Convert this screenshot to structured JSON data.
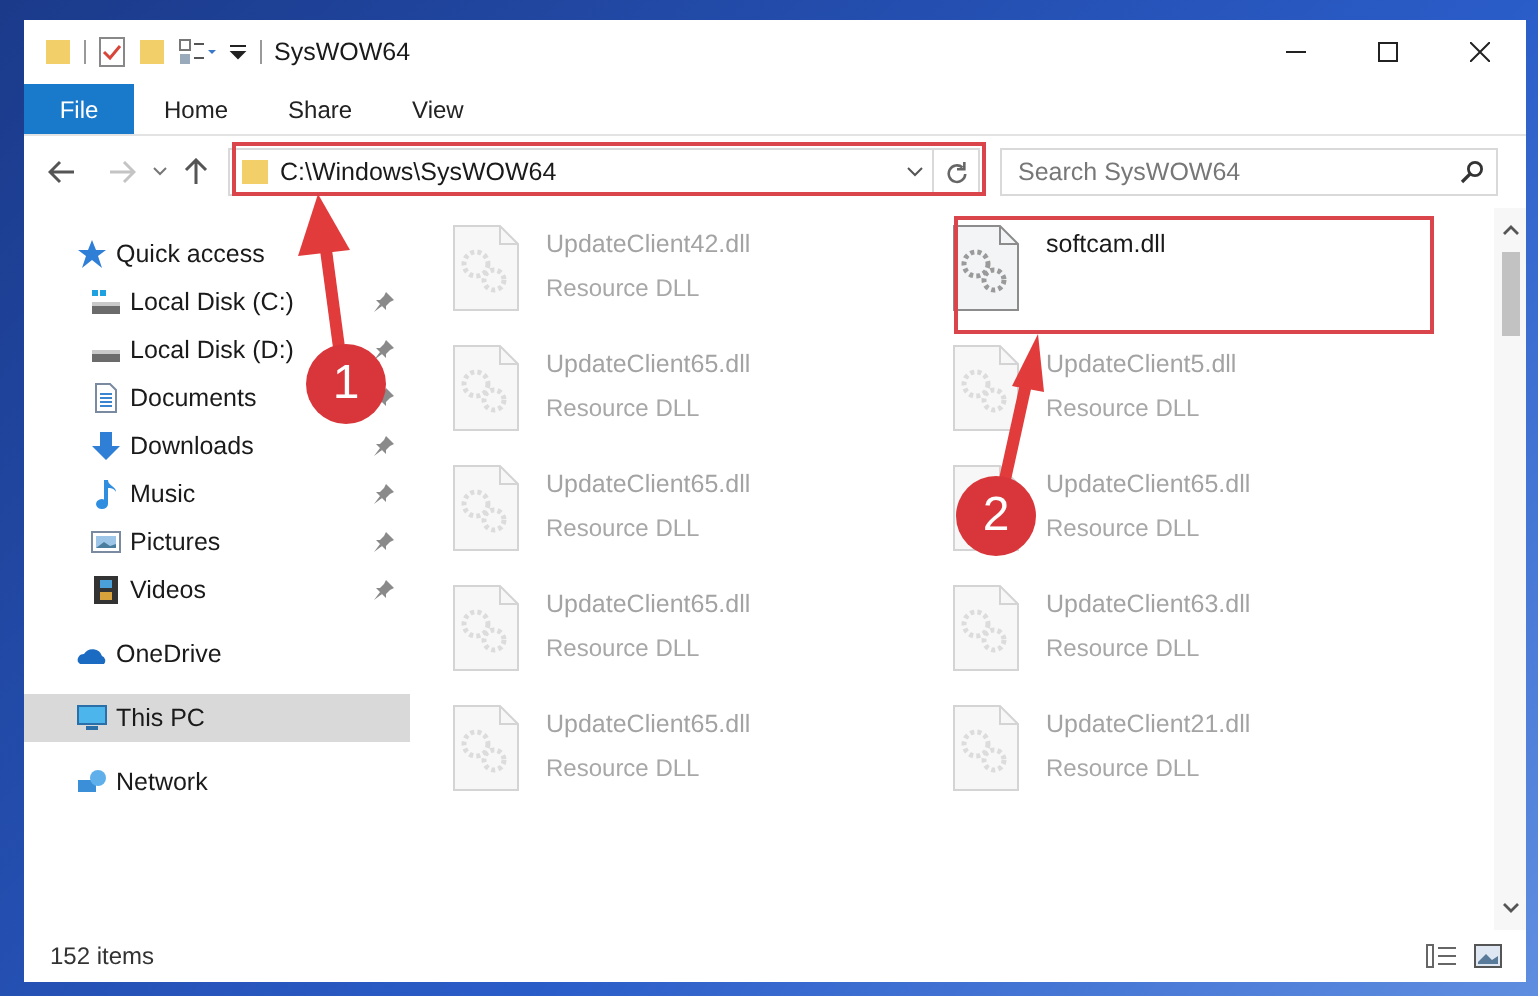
{
  "window": {
    "title": "SysWOW64"
  },
  "ribbon_tabs": [
    {
      "label": "File",
      "selected": true
    },
    {
      "label": "Home",
      "selected": false
    },
    {
      "label": "Share",
      "selected": false
    },
    {
      "label": "View",
      "selected": false
    }
  ],
  "address": {
    "path": "C:\\Windows\\SysWOW64"
  },
  "search": {
    "placeholder": "Search SysWOW64"
  },
  "sidebar": {
    "items": [
      {
        "label": "Quick access",
        "kind": "star",
        "selected": false,
        "children": [
          {
            "label": "Local Disk (C:)",
            "kind": "disk_c",
            "pinned": true,
            "selected": false
          },
          {
            "label": "Local Disk (D:)",
            "kind": "disk",
            "pinned": true,
            "selected": false
          },
          {
            "label": "Documents",
            "kind": "documents",
            "pinned": true,
            "selected": false
          },
          {
            "label": "Downloads",
            "kind": "downloads",
            "pinned": true,
            "selected": false
          },
          {
            "label": "Music",
            "kind": "music",
            "pinned": true,
            "selected": false
          },
          {
            "label": "Pictures",
            "kind": "pictures",
            "pinned": true,
            "selected": false
          },
          {
            "label": "Videos",
            "kind": "videos",
            "pinned": true,
            "selected": false
          }
        ]
      },
      {
        "label": "OneDrive",
        "kind": "cloud",
        "selected": false
      },
      {
        "label": "This PC",
        "kind": "pc",
        "selected": true
      },
      {
        "label": "Network",
        "kind": "network",
        "selected": false
      }
    ]
  },
  "files": [
    {
      "name": "UpdateClient42.dll",
      "type": "Resource DLL",
      "blurred": true
    },
    {
      "name": "softcam.dll",
      "blurred": false
    },
    {
      "name": "UpdateClient65.dll",
      "type": "Resource DLL",
      "blurred": true
    },
    {
      "name": "UpdateClient5.dll",
      "type": "Resource DLL",
      "blurred": true
    },
    {
      "name": "UpdateClient65.dll",
      "type": "Resource DLL",
      "blurred": true
    },
    {
      "name": "UpdateClient65.dll",
      "type": "Resource DLL",
      "blurred": true
    },
    {
      "name": "UpdateClient65.dll",
      "type": "Resource DLL",
      "blurred": true
    },
    {
      "name": "UpdateClient63.dll",
      "type": "Resource DLL",
      "blurred": true
    },
    {
      "name": "UpdateClient65.dll",
      "type": "Resource DLL",
      "blurred": true
    },
    {
      "name": "UpdateClient21.dll",
      "type": "Resource DLL",
      "blurred": true
    }
  ],
  "status_bar": {
    "count": "152 items"
  },
  "annotations": [
    {
      "label": "1"
    },
    {
      "label": "2"
    }
  ]
}
